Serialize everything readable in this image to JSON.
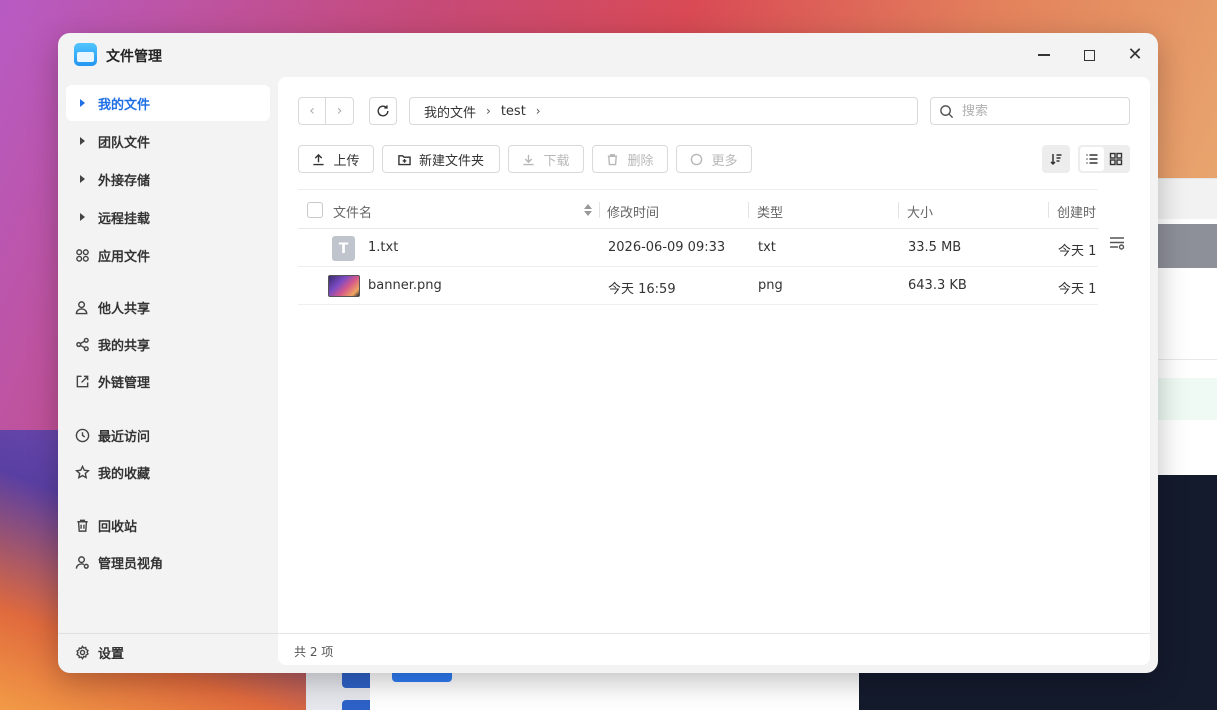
{
  "app": {
    "title": "文件管理"
  },
  "sidebar": {
    "items": [
      {
        "label": "我的文件",
        "icon": "caret-right-icon",
        "active": true
      },
      {
        "label": "团队文件",
        "icon": "caret-right-icon"
      },
      {
        "label": "外接存储",
        "icon": "caret-right-icon"
      },
      {
        "label": "远程挂载",
        "icon": "caret-right-icon"
      },
      {
        "label": "应用文件",
        "icon": "grid-icon"
      },
      {
        "label": "他人共享",
        "icon": "user-icon"
      },
      {
        "label": "我的共享",
        "icon": "share-icon"
      },
      {
        "label": "外链管理",
        "icon": "external-link-icon"
      },
      {
        "label": "最近访问",
        "icon": "clock-icon"
      },
      {
        "label": "我的收藏",
        "icon": "star-icon"
      },
      {
        "label": "回收站",
        "icon": "trash-icon"
      },
      {
        "label": "管理员视角",
        "icon": "admin-user-icon"
      }
    ],
    "settings_label": "设置"
  },
  "breadcrumb": {
    "items": [
      "我的文件",
      "test"
    ]
  },
  "search": {
    "placeholder": "搜索"
  },
  "toolbar": {
    "upload": "上传",
    "new_folder": "新建文件夹",
    "download": "下载",
    "delete": "删除",
    "more": "更多"
  },
  "table": {
    "columns": [
      "文件名",
      "修改时间",
      "类型",
      "大小",
      "创建时"
    ],
    "rows": [
      {
        "name": "1.txt",
        "modified": "2026-06-09 09:33",
        "type": "txt",
        "size": "33.5 MB",
        "created": "今天 1",
        "icon": "txt-file-icon",
        "icon_letter": "T"
      },
      {
        "name": "banner.png",
        "modified": "今天 16:59",
        "type": "png",
        "size": "643.3 KB",
        "created": "今天 1",
        "icon": "image-thumbnail-icon"
      }
    ]
  },
  "status": {
    "count_text": "共 2 项"
  },
  "colors": {
    "accent": "#1f6fe5",
    "window_bg": "#f3f3f3",
    "main_bg": "#ffffff"
  }
}
